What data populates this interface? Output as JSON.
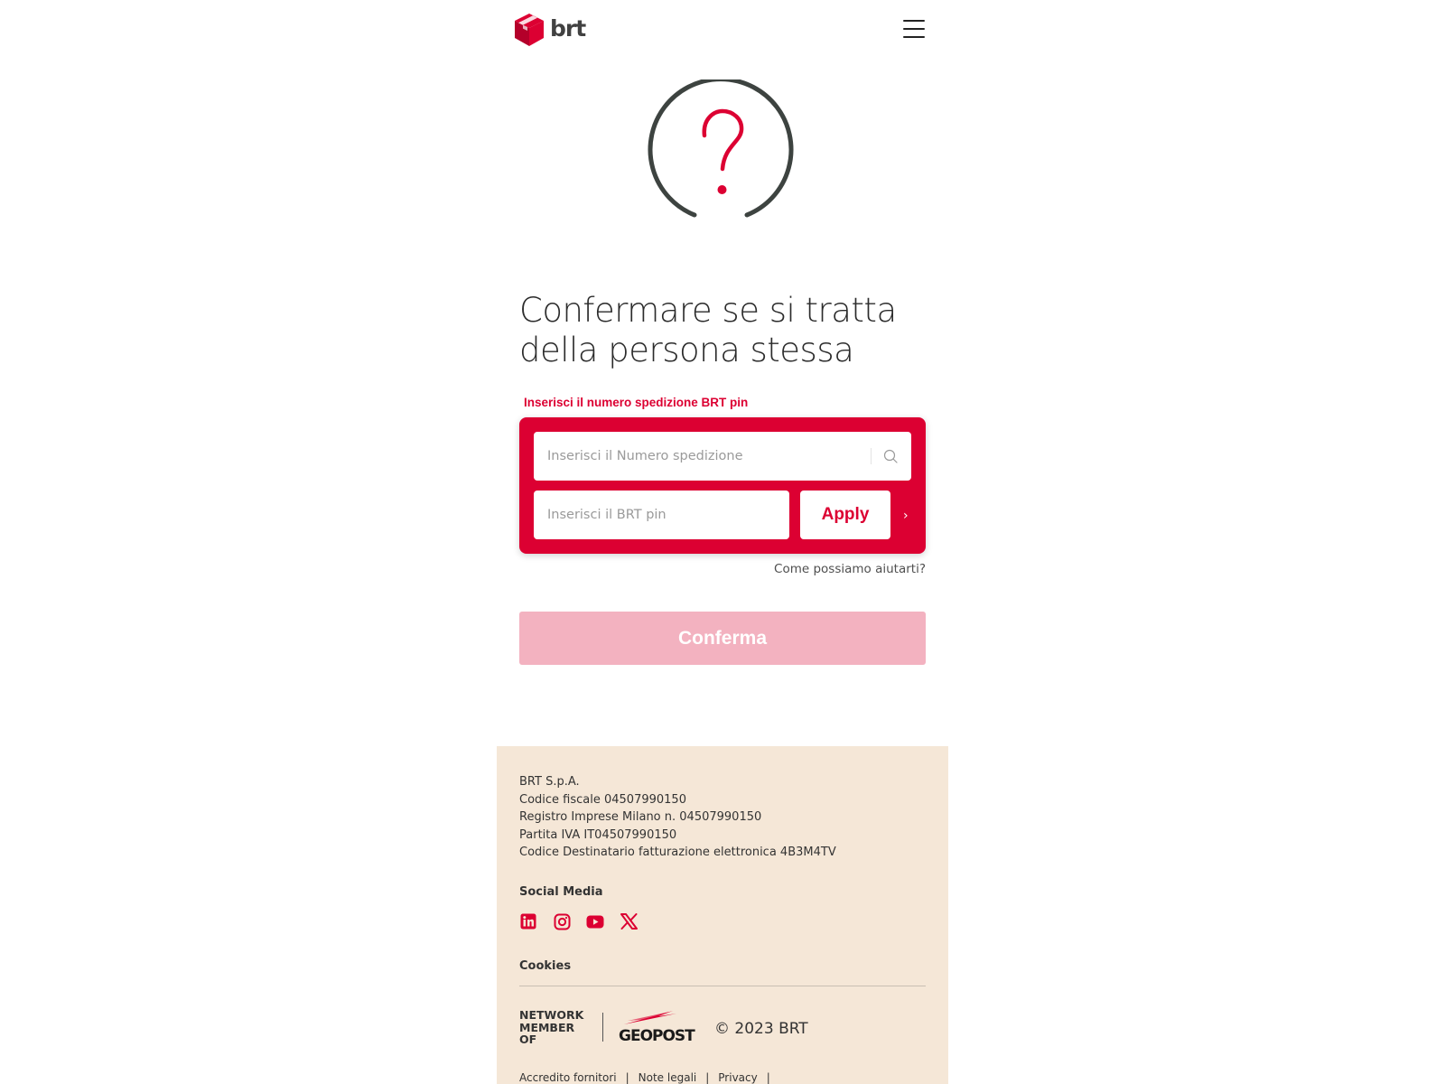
{
  "header": {
    "logo_text": "brt",
    "menu_icon": "hamburger-menu-icon",
    "brand_color": "#dc0032"
  },
  "hero": {
    "icon": "question-mark-icon"
  },
  "page_title_line1": "Confermare se si tratta",
  "page_title_line2": "della persona stessa",
  "form": {
    "label": "Inserisci il numero spedizione BRT pin",
    "shipment_placeholder": "Inserisci il Numero spedizione",
    "shipment_value": "",
    "pin_placeholder": "Inserisci il BRT pin",
    "pin_value": "",
    "apply_label": "Apply",
    "chevron": "›",
    "search_icon": "search-icon"
  },
  "help_link": "Come possiamo aiutarti?",
  "confirm_label": "Conferma",
  "footer": {
    "company": [
      "BRT S.p.A.",
      "Codice fiscale 04507990150",
      "Registro Imprese Milano n. 04507990150",
      "Partita IVA IT04507990150",
      "Codice Destinatario fatturazione elettronica 4B3M4TV"
    ],
    "social_title": "Social Media",
    "social_icons": [
      "linkedin-icon",
      "instagram-icon",
      "youtube-icon",
      "x-icon"
    ],
    "cookies": "Cookies",
    "network_line1": "NETWORK",
    "network_line2": "MEMBER",
    "network_line3": "OF",
    "partner_logo": "GEOPOST",
    "copyright": "© 2023 BRT",
    "links": [
      "Accredito fornitori",
      "Note legali",
      "Privacy"
    ],
    "link_separator": "|",
    "background": "#f5e7d7"
  }
}
